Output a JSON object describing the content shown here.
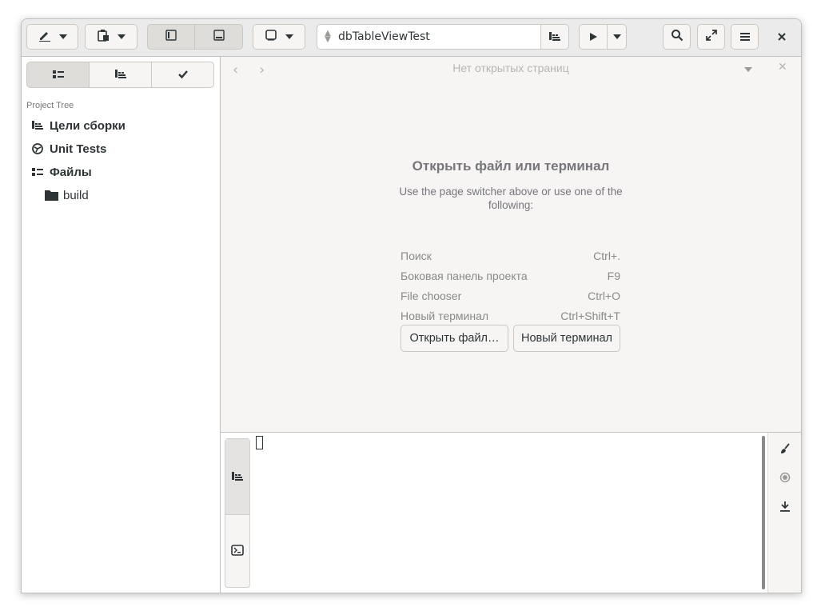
{
  "headerbar": {
    "path_value": "dbTableViewTest",
    "icons": {
      "edit": "pencil-icon",
      "attach": "clipboard-icon",
      "left_panel": "sidebar-left-icon",
      "bottom_panel": "panel-bottom-icon",
      "window": "window-icon",
      "build_targets": "build-icon",
      "run": "play-icon",
      "search": "search-icon",
      "fullscreen": "fullscreen-icon",
      "menu": "hamburger-icon",
      "close": "close-icon"
    }
  },
  "sidebar": {
    "switcher": [
      "list-icon",
      "build-icon",
      "check-icon"
    ],
    "section_label": "Project Tree",
    "items": [
      {
        "label": "Цели сборки",
        "icon": "build-icon"
      },
      {
        "label": "Unit Tests",
        "icon": "tests-icon"
      },
      {
        "label": "Файлы",
        "icon": "files-icon"
      },
      {
        "label": "build",
        "icon": "folder-icon"
      }
    ]
  },
  "main": {
    "no_pages": "Нет открытых страниц",
    "title": "Открыть файл или терминал",
    "description": "Use the page switcher above or use one of the following:",
    "shortcuts": [
      {
        "label": "Поиск",
        "key": "Ctrl+."
      },
      {
        "label": "Боковая панель проекта",
        "key": "F9"
      },
      {
        "label": "File chooser",
        "key": "Ctrl+O"
      },
      {
        "label": "Новый терминал",
        "key": "Ctrl+Shift+T"
      }
    ],
    "open_file_button": "Открыть файл…",
    "new_terminal_button": "Новый терминал"
  },
  "bottom_panel": {
    "tabs": [
      "build-icon",
      "terminal-icon"
    ],
    "tools": [
      "brush-icon",
      "record-icon",
      "download-icon"
    ]
  }
}
